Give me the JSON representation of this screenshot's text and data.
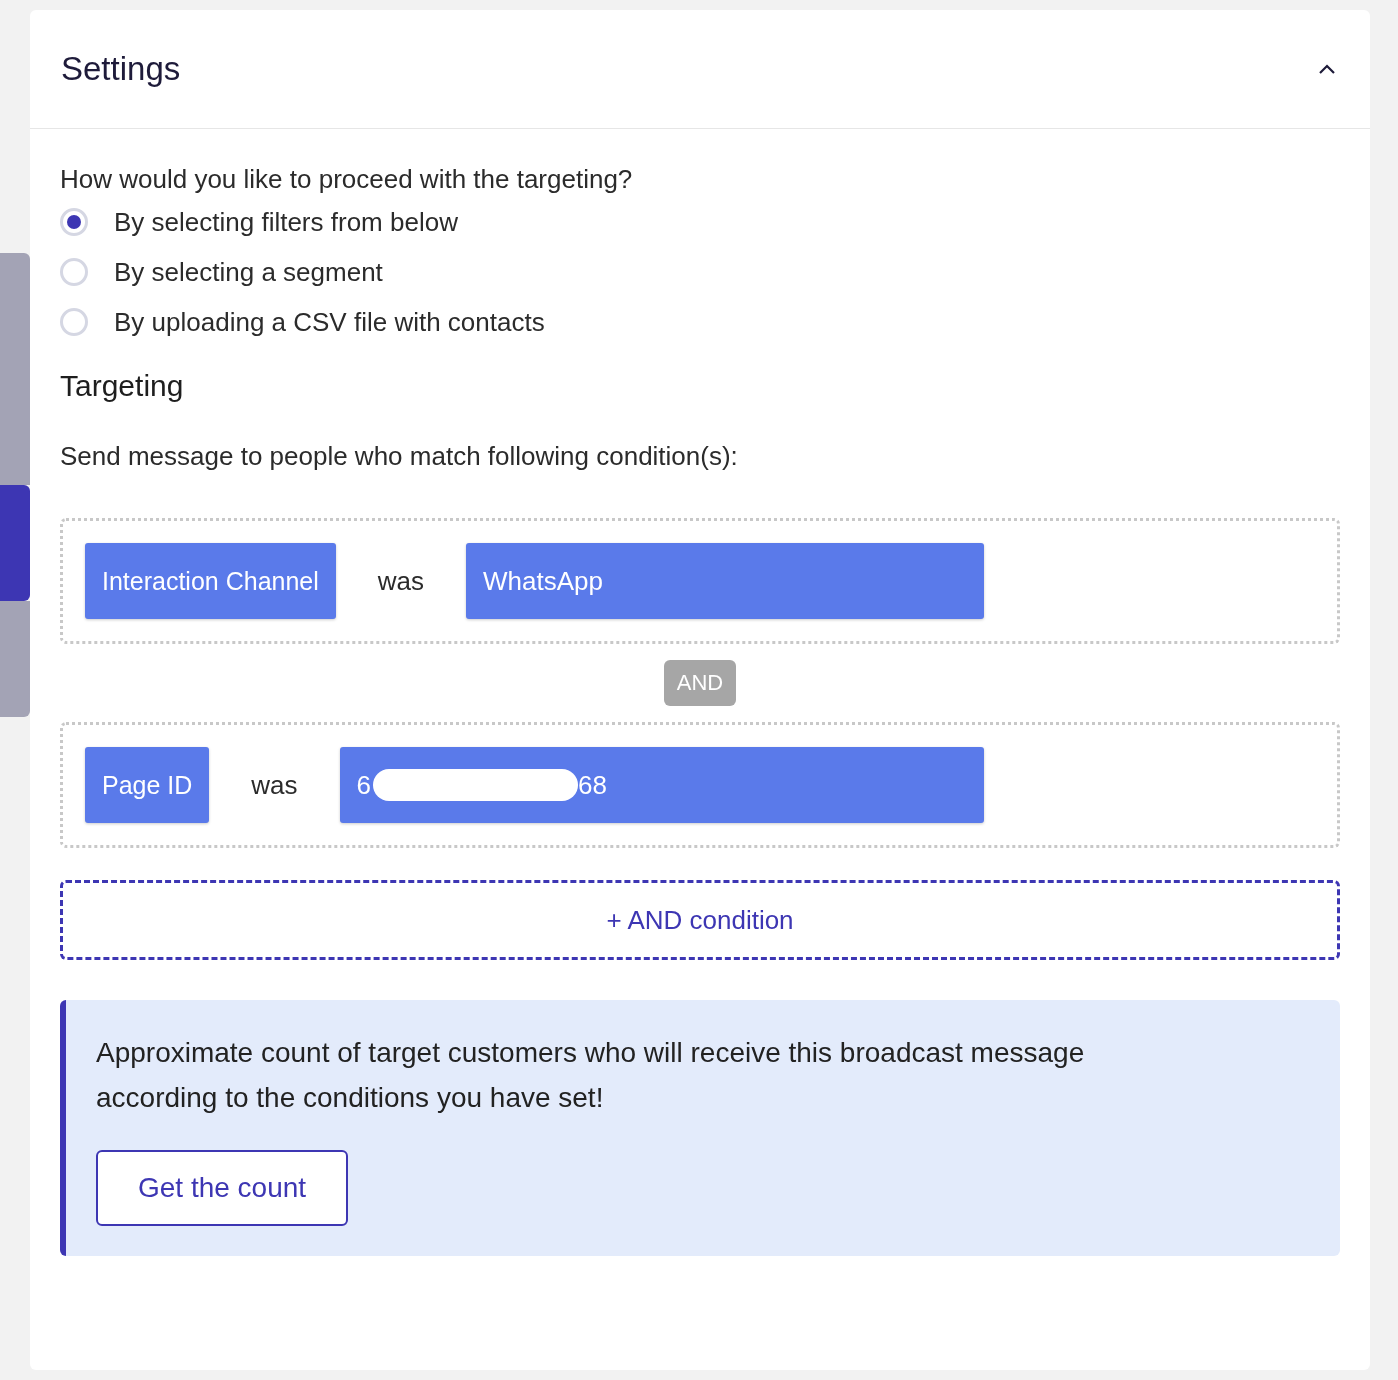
{
  "sidebar": {
    "tabs": [
      {
        "selected": false
      },
      {
        "selected": true
      },
      {
        "selected": false
      }
    ]
  },
  "panel": {
    "title": "Settings",
    "expanded": true
  },
  "question": "How would you like to proceed with the targeting?",
  "options": [
    {
      "label": "By selecting filters from below",
      "selected": true
    },
    {
      "label": "By selecting a segment",
      "selected": false
    },
    {
      "label": "By uploading a CSV file with contacts",
      "selected": false
    }
  ],
  "targeting": {
    "heading": "Targeting",
    "description": "Send message to people who match following condition(s):"
  },
  "conditions": [
    {
      "field": "Interaction Channel",
      "operator": "was",
      "value_start": "WhatsApp",
      "redacted": false
    },
    {
      "field": "Page ID",
      "operator": "was",
      "value_start": "6",
      "redacted": true,
      "value_end": "68"
    }
  ],
  "joiner": "AND",
  "add_button": "+ AND condition",
  "count_box": {
    "text": "Approximate count of target customers who will receive this broadcast message according to the conditions you have set!",
    "button": "Get the count"
  }
}
